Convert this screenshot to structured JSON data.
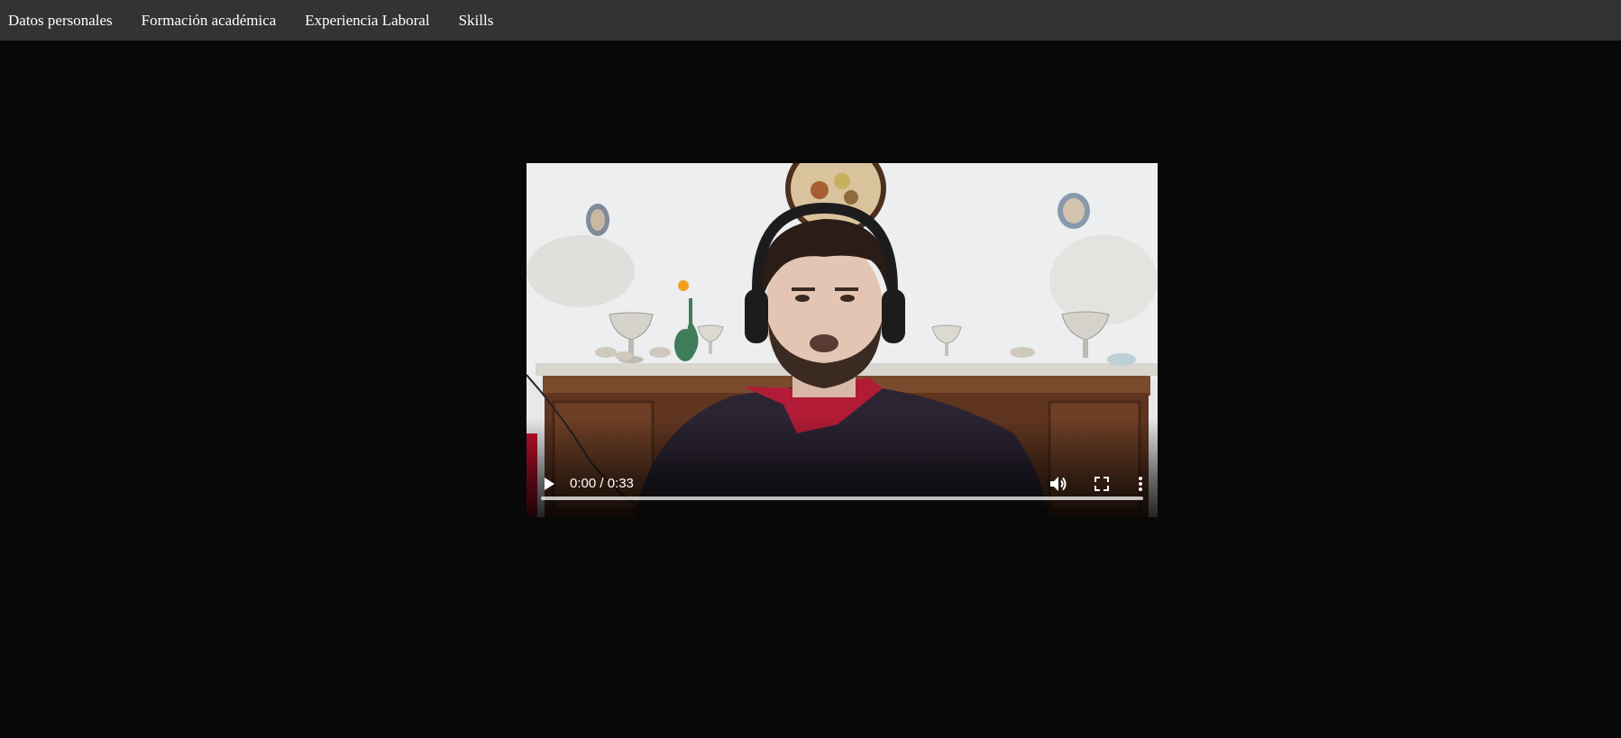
{
  "nav": {
    "items": [
      {
        "label": "Datos personales"
      },
      {
        "label": "Formación académica"
      },
      {
        "label": "Experiencia Laboral"
      },
      {
        "label": "Skills"
      }
    ]
  },
  "video": {
    "current_time": "0:00",
    "duration": "0:33",
    "time_display": "0:00 / 0:33",
    "progress": 0,
    "controls": {
      "play_icon": "play-icon",
      "volume_icon": "volume-icon",
      "fullscreen_icon": "fullscreen-icon",
      "more_icon": "more-vertical-icon"
    }
  },
  "colors": {
    "page_background": "#080808",
    "nav_background": "#333333",
    "nav_text": "#ffffff"
  }
}
